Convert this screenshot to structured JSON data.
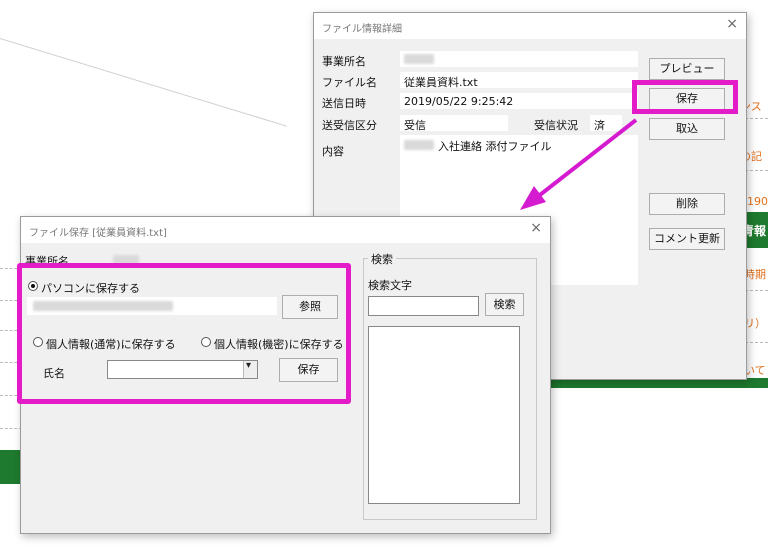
{
  "background": {
    "left_items": [
      "",
      "",
      "",
      "",
      "",
      ""
    ],
    "right_items": {
      "item1": "ンス",
      "item2": "の記",
      "item3": "0190",
      "item4": "青報",
      "item5": "時期",
      "item6": "リ）",
      "item7": "いて"
    }
  },
  "detail_dialog": {
    "title": "ファイル情報詳細",
    "close": "×",
    "labels": {
      "office": "事業所名",
      "filename": "ファイル名",
      "sent_at": "送信日時",
      "type": "送受信区分",
      "status": "受信状況",
      "content": "内容"
    },
    "values": {
      "filename": "従業員資料.txt",
      "sent_at": "2019/05/22 9:25:42",
      "type": "受信",
      "status": "済",
      "content": "入社連絡 添付ファイル"
    },
    "buttons": {
      "preview": "プレビュー",
      "save": "保存",
      "import": "取込",
      "delete": "削除",
      "comment": "コメント更新"
    }
  },
  "save_dialog": {
    "title": "ファイル保存 [従業員資料.txt]",
    "close": "×",
    "office_label": "事業所名",
    "opt_pc": "パソコンに保存する",
    "browse": "参照",
    "opt_normal": "個人情報(通常)に保存する",
    "opt_secret": "個人情報(機密)に保存する",
    "name_label": "氏名",
    "name_value": "",
    "save": "保存",
    "search_group": "検索",
    "search_label": "検索文字",
    "search_value": "",
    "search_btn": "検索"
  },
  "colors": {
    "highlight": "#e31cc8",
    "arrow": "#d41bd0",
    "bg_green": "#1e7a2e",
    "bg_orange": "#e06f1a"
  }
}
